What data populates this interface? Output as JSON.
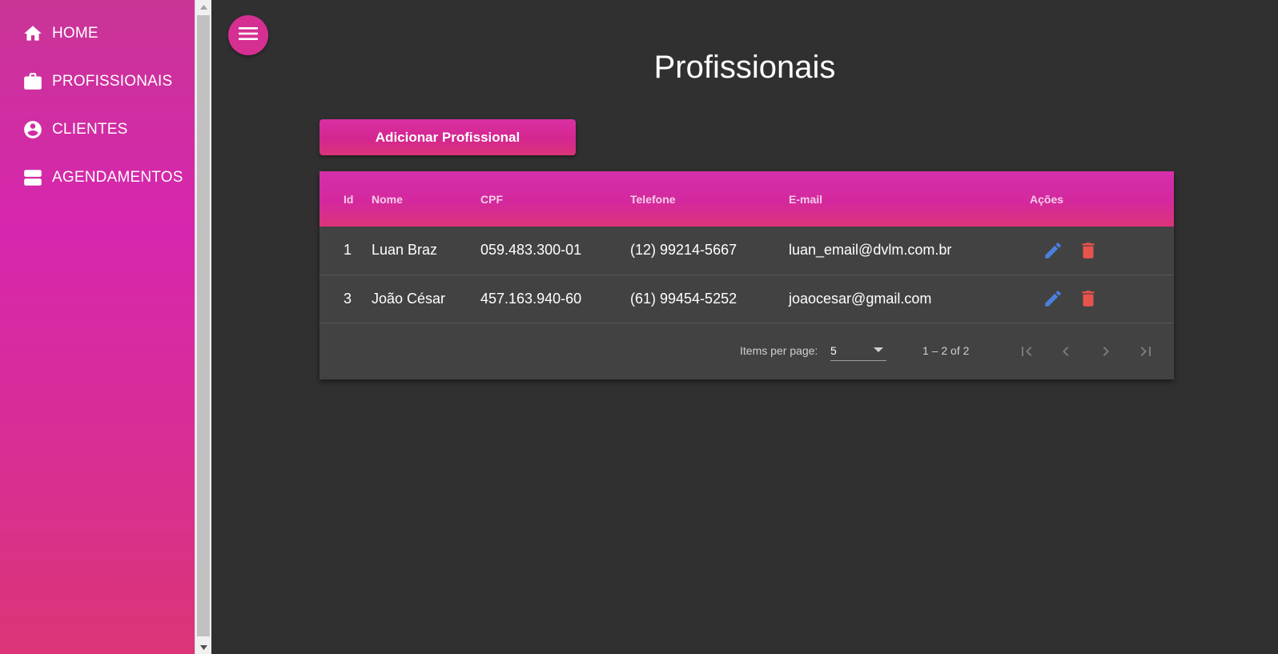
{
  "sidebar": {
    "items": [
      {
        "label": "HOME",
        "icon": "home-icon"
      },
      {
        "label": "PROFISSIONAIS",
        "icon": "briefcase-icon"
      },
      {
        "label": "CLIENTES",
        "icon": "account-circle-icon"
      },
      {
        "label": "AGENDAMENTOS",
        "icon": "storage-icon"
      }
    ]
  },
  "header": {
    "menu_icon": "menu-icon",
    "title": "Profissionais"
  },
  "toolbar": {
    "add_label": "Adicionar Profissional"
  },
  "table": {
    "columns": [
      "Id",
      "Nome",
      "CPF",
      "Telefone",
      "E-mail",
      "Ações"
    ],
    "rows": [
      {
        "id": "1",
        "nome": "Luan Braz",
        "cpf": "059.483.300-01",
        "telefone": "(12) 99214-5667",
        "email": "luan_email@dvlm.com.br"
      },
      {
        "id": "3",
        "nome": "João César",
        "cpf": "457.163.940-60",
        "telefone": "(61) 99454-5252",
        "email": "joaocesar@gmail.com"
      }
    ]
  },
  "paginator": {
    "items_per_page_label": "Items per page:",
    "page_size": "5",
    "range_label": "1 – 2 of 2"
  },
  "colors": {
    "accent": "#d62f92",
    "edit": "#4a7fe0",
    "delete": "#e8534c",
    "background": "#303030",
    "card": "#424242"
  }
}
